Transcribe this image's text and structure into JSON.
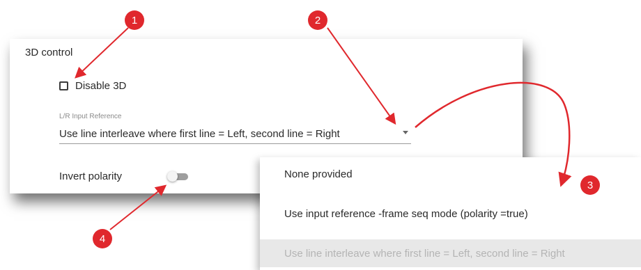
{
  "panel": {
    "title": "3D control",
    "disable_3d": {
      "label": "Disable 3D",
      "checked": false
    },
    "lr_input_reference": {
      "caption": "L/R Input Reference",
      "value": "Use line interleave where first line = Left, second line = Right"
    },
    "invert_polarity": {
      "label": "Invert polarity",
      "on": false
    }
  },
  "dropdown": {
    "options": [
      {
        "label": "None provided",
        "selected": false
      },
      {
        "label": "Use input reference -frame seq mode (polarity =true)",
        "selected": false
      },
      {
        "label": "Use line interleave where first line = Left, second line = Right",
        "selected": true
      }
    ]
  },
  "callouts": [
    "1",
    "2",
    "3",
    "4"
  ],
  "colors": {
    "callout": "#e0282d",
    "arrow": "#e0282d",
    "selected_option_bg": "#e8e8e8",
    "toggle_track": "#9e9e9e"
  }
}
